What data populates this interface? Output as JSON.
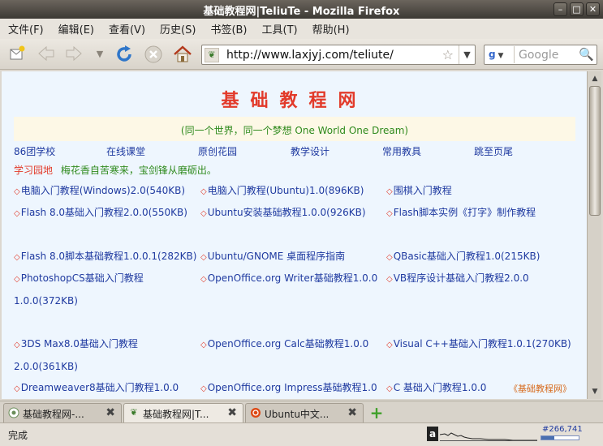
{
  "window": {
    "title": "基础教程网|TeliuTe - Mozilla Firefox",
    "controls": [
      "–",
      "□",
      "✕"
    ]
  },
  "menubar": [
    "文件(F)",
    "编辑(E)",
    "查看(V)",
    "历史(S)",
    "书签(B)",
    "工具(T)",
    "帮助(H)"
  ],
  "toolbar": {
    "url": "http://www.laxjyj.com/teliute/",
    "search_engine_icon": "google-icon",
    "search_placeholder": "Google",
    "icons": [
      "new-page-icon",
      "back-icon",
      "forward-icon",
      "history-dropdown-icon",
      "reload-icon",
      "stop-icon",
      "home-icon"
    ]
  },
  "page": {
    "site_title": "基础教程网",
    "motto": "(同一个世界，同一个梦想 One World One Dream)",
    "nav_links": [
      "86团学校",
      "在线课堂",
      "原创花园",
      "教学设计",
      "常用教具",
      "跳至页尾"
    ],
    "section_title": "学习园地",
    "section_tagline": "梅花香自苦寒来，宝剑锋从磨砺出。",
    "courses": [
      {
        "col": 0,
        "row": 0,
        "text": "电脑入门教程(Windows)2.0(540KB)"
      },
      {
        "col": 1,
        "row": 0,
        "text": "电脑入门教程(Ubuntu)1.0(896KB)"
      },
      {
        "col": 2,
        "row": 0,
        "text": "围棋入门教程"
      },
      {
        "col": 0,
        "row": 1,
        "text": "Flash 8.0基础入门教程2.0.0(550KB)"
      },
      {
        "col": 1,
        "row": 1,
        "text": "Ubuntu安装基础教程1.0.0(926KB)"
      },
      {
        "col": 2,
        "row": 1,
        "text": "Flash脚本实例《打字》制作教程"
      },
      {
        "col": 0,
        "row": 2,
        "text": "Flash 8.0脚本基础教程1.0.0.1(282KB)"
      },
      {
        "col": 1,
        "row": 2,
        "text": "Ubuntu/GNOME 桌面程序指南"
      },
      {
        "col": 2,
        "row": 2,
        "text": "QBasic基础入门教程1.0(215KB)"
      },
      {
        "col": 0,
        "row": 3,
        "text": "PhotoshopCS基础入门教程",
        "cont": "1.0.0(372KB)"
      },
      {
        "col": 1,
        "row": 3,
        "text": "OpenOffice.org Writer基础教程1.0.0"
      },
      {
        "col": 2,
        "row": 3,
        "text": "VB程序设计基础入门教程2.0.0"
      },
      {
        "col": 0,
        "row": 4,
        "text": "3DS Max8.0基础入门教程",
        "cont": "2.0.0(361KB)"
      },
      {
        "col": 1,
        "row": 4,
        "text": "OpenOffice.org Calc基础教程1.0.0"
      },
      {
        "col": 2,
        "row": 4,
        "text": "Visual C++基础入门教程1.0.1(270KB)"
      },
      {
        "col": 0,
        "row": 5,
        "text": "Dreamweaver8基础入门教程1.0.0"
      },
      {
        "col": 1,
        "row": 5,
        "text": "OpenOffice.org Impress基础教程1.0"
      },
      {
        "col": 2,
        "row": 5,
        "text": "C 基础入门教程1.0.0"
      }
    ],
    "more_link": "《基础教程网》"
  },
  "tabs": [
    {
      "label": "基础教程网-...",
      "icon": "page-icon",
      "active": false
    },
    {
      "label": "基础教程网|T...",
      "icon": "leaf-icon",
      "active": true
    },
    {
      "label": "Ubuntu中文...",
      "icon": "ubuntu-icon",
      "active": false
    }
  ],
  "statusbar": {
    "text": "完成",
    "alexa_rank": "#266,741",
    "rank_fraction": 0.35
  },
  "colors": {
    "title_red": "#e23a2a",
    "link_blue": "#1f3aa0",
    "motto_green": "#2f8a1d",
    "page_bg": "#eef6fe"
  }
}
